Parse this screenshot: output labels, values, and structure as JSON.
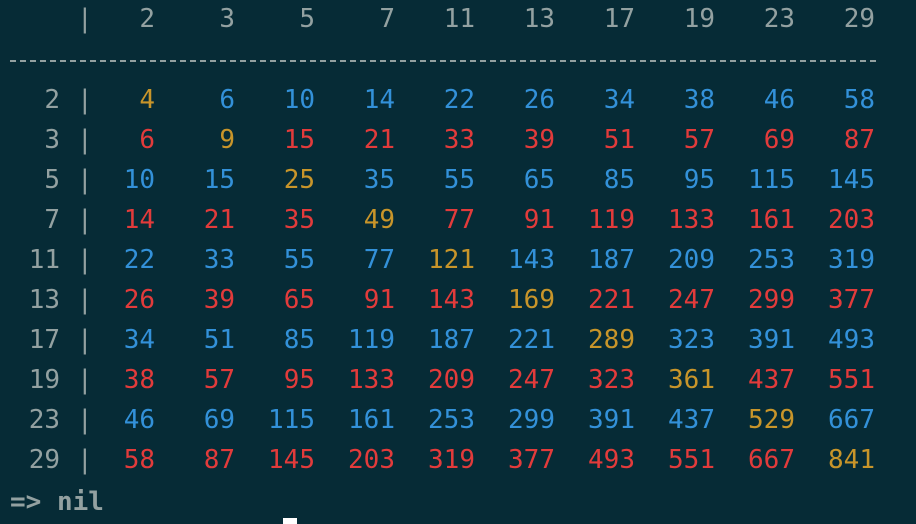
{
  "primes": [
    "2",
    "3",
    "5",
    "7",
    "11",
    "13",
    "17",
    "19",
    "23",
    "29"
  ],
  "separator": "|",
  "rows": [
    [
      "4",
      "6",
      "10",
      "14",
      "22",
      "26",
      "34",
      "38",
      "46",
      "58"
    ],
    [
      "6",
      "9",
      "15",
      "21",
      "33",
      "39",
      "51",
      "57",
      "69",
      "87"
    ],
    [
      "10",
      "15",
      "25",
      "35",
      "55",
      "65",
      "85",
      "95",
      "115",
      "145"
    ],
    [
      "14",
      "21",
      "35",
      "49",
      "77",
      "91",
      "119",
      "133",
      "161",
      "203"
    ],
    [
      "22",
      "33",
      "55",
      "77",
      "121",
      "143",
      "187",
      "209",
      "253",
      "319"
    ],
    [
      "26",
      "39",
      "65",
      "91",
      "143",
      "169",
      "221",
      "247",
      "299",
      "377"
    ],
    [
      "34",
      "51",
      "85",
      "119",
      "187",
      "221",
      "289",
      "323",
      "391",
      "493"
    ],
    [
      "38",
      "57",
      "95",
      "133",
      "209",
      "247",
      "323",
      "361",
      "437",
      "551"
    ],
    [
      "46",
      "69",
      "115",
      "161",
      "253",
      "299",
      "391",
      "437",
      "529",
      "667"
    ],
    [
      "58",
      "87",
      "145",
      "203",
      "319",
      "377",
      "493",
      "551",
      "667",
      "841"
    ]
  ],
  "colors": {
    "background": "#062b36",
    "label": "#93a1a1",
    "diagonal": "#c8952a",
    "even_row": "#3391d9",
    "odd_row": "#e23b3b"
  },
  "result_line": "=> nil"
}
